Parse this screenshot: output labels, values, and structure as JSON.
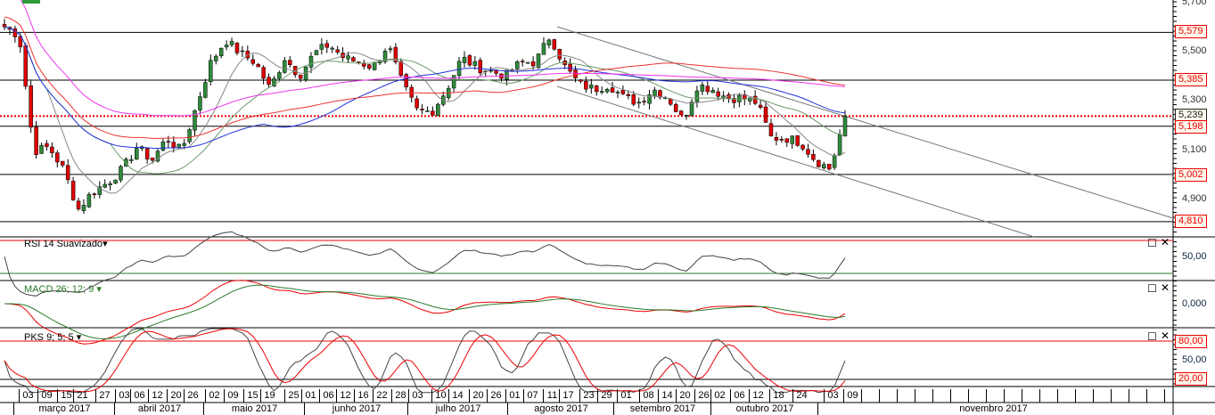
{
  "price_axis": {
    "ticks": [
      "5,700",
      "5,500",
      "5,300",
      "5,100",
      "4,900"
    ],
    "levels": [
      {
        "label": "5,579",
        "value": 5579
      },
      {
        "label": "5,385",
        "value": 5385
      },
      {
        "label": "5,198",
        "value": 5198
      },
      {
        "label": "5,002",
        "value": 5002
      },
      {
        "label": "4,810",
        "value": 4810
      }
    ],
    "current": {
      "label": "5,239",
      "value": 5239
    }
  },
  "panels": {
    "rsi": {
      "title": "RSI 14 Suavizado",
      "tick": "50,00"
    },
    "macd": {
      "title": "MACD 26; 12; 9",
      "tick": "0,000"
    },
    "pks": {
      "title": "PKS 9; 5; 5",
      "ticks": [
        "80,00",
        "50,00",
        "20,00"
      ]
    }
  },
  "dates": [
    "03",
    "09",
    "15",
    "21",
    "27",
    "03",
    "06",
    "12",
    "20",
    "26",
    "02",
    "09",
    "15",
    "19",
    "25",
    "01",
    "06",
    "12",
    "16",
    "22",
    "28",
    "03",
    "10",
    "14",
    "20",
    "26",
    "01",
    "07",
    "11",
    "17",
    "23",
    "29",
    "01",
    "08",
    "14",
    "20",
    "26",
    "02",
    "06",
    "12",
    "18",
    "24",
    "03",
    "09"
  ],
  "months": [
    "março 2017",
    "abril 2017",
    "maio 2017",
    "junho 2017",
    "julho 2017",
    "agosto 2017",
    "setembro 2017",
    "outubro 2017",
    "novembro 2017"
  ],
  "colors": {
    "up": "#2e8b3a",
    "down": "#e00000",
    "ma_fast": "#888888",
    "ma_mid": "#6a9a6a",
    "ma_slow": "#2233dd",
    "ma_red": "#ee3333",
    "ma_magenta": "#ee33ee"
  },
  "chart_data": {
    "type": "candlestick",
    "closes": [
      5602,
      5566,
      5096,
      5114,
      5023,
      4860,
      4933,
      4969,
      5023,
      5114,
      5059,
      5150,
      5096,
      5277,
      5458,
      5548,
      5494,
      5458,
      5349,
      5476,
      5403,
      5494,
      5530,
      5476,
      5458,
      5439,
      5530,
      5367,
      5258,
      5258,
      5349,
      5476,
      5439,
      5421,
      5403,
      5458,
      5458,
      5566,
      5439,
      5367,
      5349,
      5367,
      5313,
      5295,
      5349,
      5313,
      5222,
      5367,
      5349,
      5313,
      5313,
      5295,
      5150,
      5150,
      5132,
      5059,
      5023,
      5239
    ]
  }
}
